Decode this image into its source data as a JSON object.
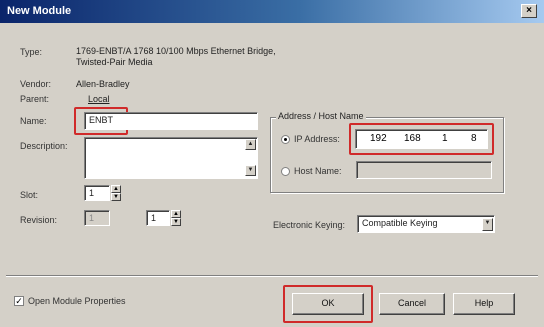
{
  "window": {
    "title": "New Module",
    "close_glyph": "×"
  },
  "labels": {
    "type": "Type:",
    "vendor": "Vendor:",
    "parent": "Parent:",
    "name": "Name:",
    "description": "Description:",
    "slot": "Slot:",
    "revision": "Revision:",
    "address_group": "Address / Host Name",
    "ip_address": "IP Address:",
    "host_name": "Host Name:",
    "electronic_keying": "Electronic Keying:"
  },
  "values": {
    "type_line1": "1769-ENBT/A 1768 10/100 Mbps Ethernet Bridge,",
    "type_line2": "Twisted-Pair Media",
    "vendor": "Allen-Bradley",
    "parent": "Local",
    "name": "ENBT",
    "slot": "1",
    "revision_major": "1",
    "revision_minor": "1",
    "ip": [
      "192",
      "168",
      "1",
      "8"
    ],
    "electronic_keying": "Compatible Keying",
    "ip_selected": true
  },
  "footer": {
    "open_module_properties": "Open Module Properties",
    "open_module_checked": "✓",
    "ok": "OK",
    "cancel": "Cancel",
    "help": "Help"
  },
  "colors": {
    "highlight_box": "#d02a2a",
    "title_bar_start": "#0a246a",
    "dialog_bg": "#d4d0c8"
  }
}
